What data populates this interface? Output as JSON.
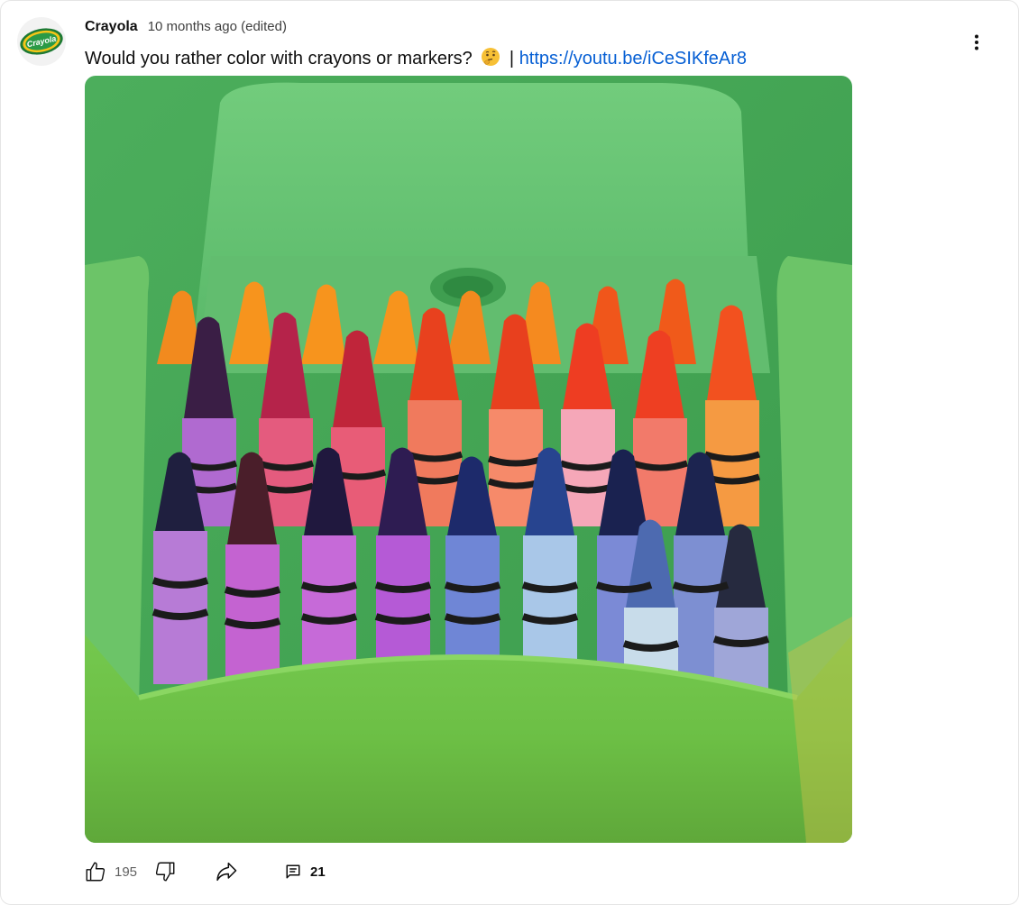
{
  "post": {
    "author": "Crayola",
    "meta": "10 months ago (edited)",
    "text": "Would you rather color with crayons or markers?",
    "separator": "|",
    "link": "https://youtu.be/iCeSIKfeAr8",
    "avatar_logo": "Crayola",
    "emoji": "thinking-face-emoji"
  },
  "actions": {
    "like_count": "195",
    "comment_count": "21",
    "icons": [
      "thumbs-up-icon",
      "thumbs-down-icon",
      "share-icon",
      "comment-icon",
      "more-vert-icon"
    ]
  },
  "colors": {
    "link": "#065fd4",
    "tray_green": "#5fbf6e"
  }
}
